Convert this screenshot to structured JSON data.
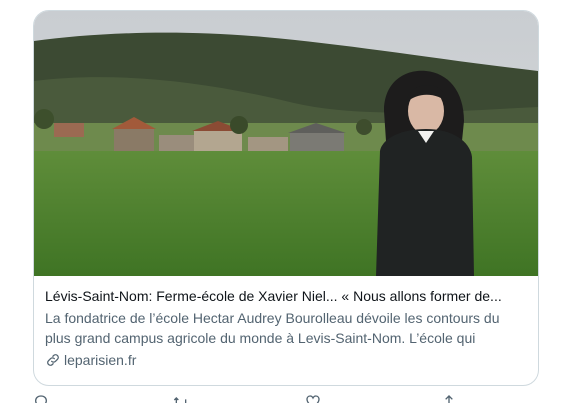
{
  "card": {
    "title": "Lévis-Saint-Nom: Ferme-école de Xavier Niel... « Nous allons former de...",
    "description": "La fondatrice de l’école Hectar Audrey Bourolleau dévoile les contours du plus grand campus agricole du monde à Levis-Saint-Nom. L’école qui",
    "domain": "leparisien.fr",
    "image_icon": "photo-landscape-woman-in-field",
    "link_icon": "link-icon"
  },
  "actions": {
    "icons": [
      "reply-icon",
      "retweet-icon",
      "like-icon",
      "share-icon"
    ]
  },
  "colors": {
    "border": "#cfd9de",
    "title": "#0f1419",
    "secondary": "#536471"
  }
}
